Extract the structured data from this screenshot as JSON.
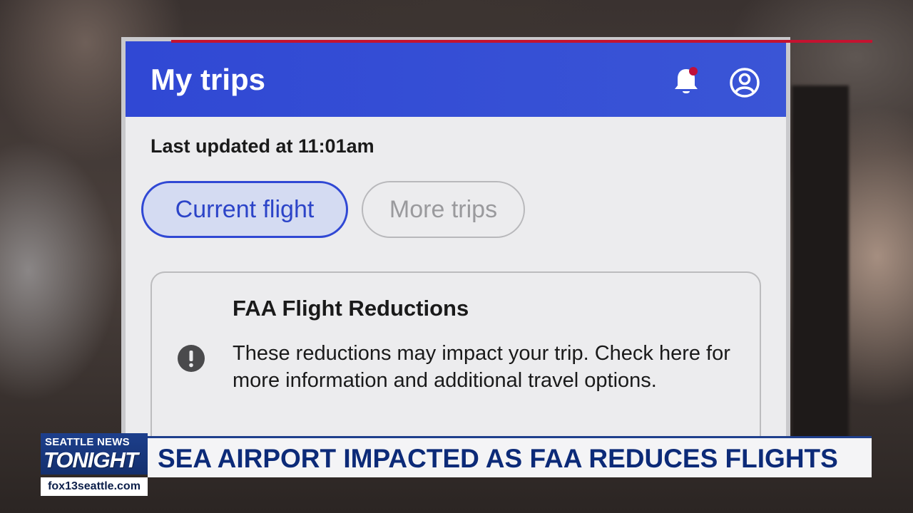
{
  "app": {
    "title": "My trips",
    "last_updated": "Last updated at 11:01am",
    "tabs": [
      {
        "label": "Current flight",
        "active": true
      },
      {
        "label": "More trips",
        "active": false
      }
    ],
    "icons": {
      "bell": "bell-icon",
      "profile": "profile-icon",
      "alert": "exclamation-circle-icon"
    },
    "notification_badge": true,
    "alert": {
      "title": "FAA Flight Reductions",
      "body": "These reductions may impact your trip. Check here for more information and additional travel options."
    },
    "colors": {
      "header": "#3048d4",
      "accent": "#2c44c8",
      "badge": "#c0103a"
    }
  },
  "broadcast": {
    "show_name_top": "SEATTLE NEWS",
    "show_name_main": "TONIGHT",
    "website": "fox13seattle.com",
    "headline": "SEA AIRPORT IMPACTED AS FAA REDUCES FLIGHTS",
    "colors": {
      "navy": "#14306e",
      "red": "#c41230",
      "headline_text": "#0c2a78"
    }
  }
}
